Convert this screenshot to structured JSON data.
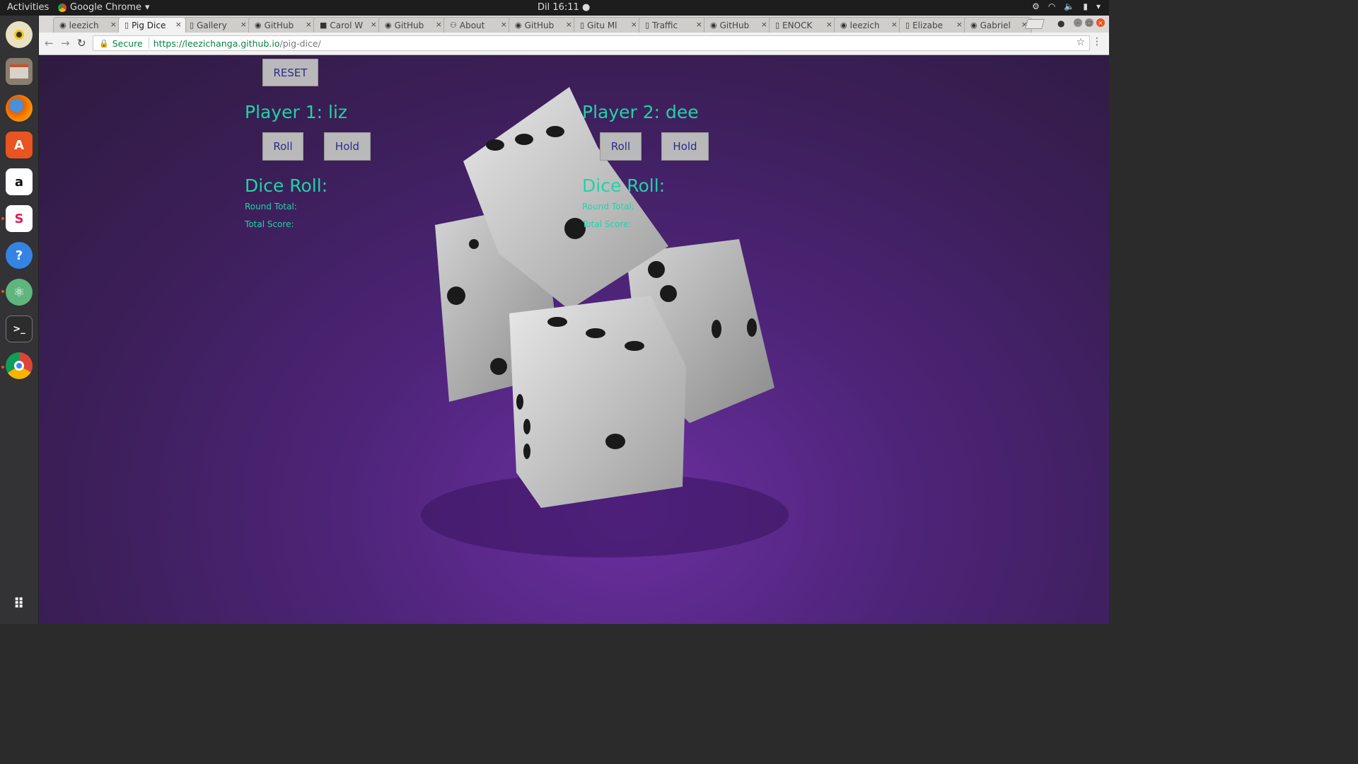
{
  "system": {
    "activities": "Activities",
    "app_name": "Google Chrome",
    "clock": "Dil 16:11"
  },
  "browser": {
    "tabs": [
      {
        "label": "leezich",
        "icon": "github-icon"
      },
      {
        "label": "Pig Dice",
        "icon": "page-icon",
        "active": true
      },
      {
        "label": "Gallery",
        "icon": "page-icon"
      },
      {
        "label": "GitHub",
        "icon": "github-icon"
      },
      {
        "label": "Carol W",
        "icon": "dark-square-icon"
      },
      {
        "label": "GitHub",
        "icon": "github-icon"
      },
      {
        "label": "About",
        "icon": "user-icon"
      },
      {
        "label": "GitHub",
        "icon": "github-icon"
      },
      {
        "label": "Gitu Ml",
        "icon": "page-icon"
      },
      {
        "label": "Traffic",
        "icon": "page-icon"
      },
      {
        "label": "GitHub",
        "icon": "github-icon"
      },
      {
        "label": "ENOCK",
        "icon": "page-icon"
      },
      {
        "label": "leezich",
        "icon": "github-icon"
      },
      {
        "label": "Elizabe",
        "icon": "page-icon"
      },
      {
        "label": "Gabriel",
        "icon": "github-icon"
      }
    ],
    "secure_label": "Secure",
    "url_host": "https://leezichanga.github.io",
    "url_path": "/pig-dice/"
  },
  "game": {
    "reset_label": "RESET",
    "player1": {
      "heading": "Player 1: liz",
      "roll_label": "Roll",
      "hold_label": "Hold",
      "dice_roll_label": "Dice Roll:",
      "round_total_label": "Round Total:",
      "total_score_label": "Total Score:"
    },
    "player2": {
      "heading": "Player 2: dee",
      "roll_label": "Roll",
      "hold_label": "Hold",
      "dice_roll_label": "Dice Roll:",
      "round_total_label": "Round Total:",
      "total_score_label": "Total Score:"
    }
  },
  "colors": {
    "accent_text": "#1fd4a8",
    "button_text": "#2b2b8a",
    "background": "#4d2478"
  }
}
